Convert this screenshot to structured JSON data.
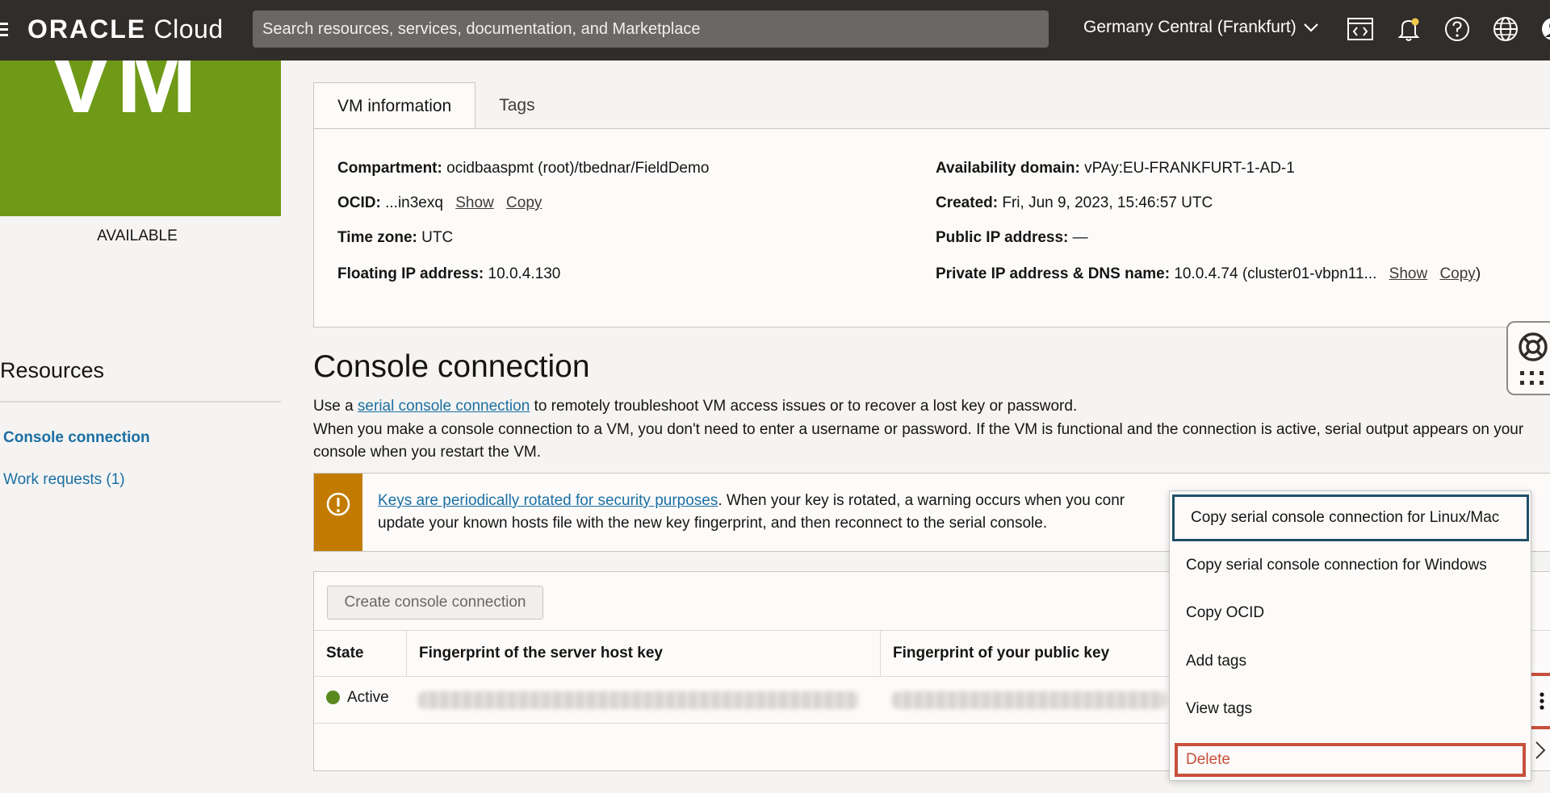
{
  "topbar": {
    "logo_brand": "ORACLE",
    "logo_product": "Cloud",
    "search_placeholder": "Search resources, services, documentation, and Marketplace",
    "region": "Germany Central (Frankfurt)"
  },
  "instance": {
    "badge_text": "VM",
    "state": "AVAILABLE"
  },
  "resources": {
    "title": "Resources",
    "items": [
      {
        "label": "Console connection",
        "active": true
      },
      {
        "label": "Work requests (1)",
        "active": false
      }
    ]
  },
  "tabs": [
    {
      "label": "VM information",
      "active": true
    },
    {
      "label": "Tags",
      "active": false
    }
  ],
  "vm_info": {
    "compartment_label": "Compartment:",
    "compartment_value": "ocidbaaspmt (root)/tbednar/FieldDemo",
    "ocid_label": "OCID:",
    "ocid_value": "...in3exq",
    "show_label": "Show",
    "copy_label": "Copy",
    "timezone_label": "Time zone:",
    "timezone_value": "UTC",
    "floating_ip_label": "Floating IP address:",
    "floating_ip_value": "10.0.4.130",
    "ad_label": "Availability domain:",
    "ad_value": "vPAy:EU-FRANKFURT-1-AD-1",
    "created_label": "Created:",
    "created_value": "Fri, Jun 9, 2023, 15:46:57 UTC",
    "public_ip_label": "Public IP address:",
    "public_ip_value": "—",
    "private_ip_label": "Private IP address & DNS name:",
    "private_ip_value": "10.0.4.74 (cluster01-vbpn11...",
    "private_show": "Show",
    "private_copy": "Copy",
    "private_close": ")"
  },
  "console": {
    "heading": "Console connection",
    "intro_prefix": "Use a ",
    "intro_link": "serial console connection",
    "intro_suffix": " to remotely troubleshoot VM access issues or to recover a lost key or password.",
    "detail": "When you make a console connection to a VM, you don't need to enter a username or password. If the VM is functional and the connection is active, serial output appears on your console when you restart the VM.",
    "warning_link": "Keys are periodically rotated for security purposes",
    "warning_text_1": ". When your key is rotated, a warning occurs when you conr",
    "warning_text_2": "update your known hosts file with the new key fingerprint, and then reconnect to the serial console.",
    "create_button": "Create console connection",
    "columns": [
      "State",
      "Fingerprint of the server host key",
      "Fingerprint of your public key"
    ],
    "rows": [
      {
        "state": "Active"
      }
    ]
  },
  "action_menu": {
    "items": [
      "Copy serial console connection for Linux/Mac",
      "Copy serial console connection for Windows",
      "Copy OCID",
      "Add tags",
      "View tags",
      "Delete"
    ]
  },
  "colors": {
    "topbar": "#312d2a",
    "vm_badge": "#6f9a18",
    "link": "#1b6fa3",
    "warning": "#c27b00",
    "highlight": "#c7503c",
    "active_status": "#5a8a1e"
  }
}
